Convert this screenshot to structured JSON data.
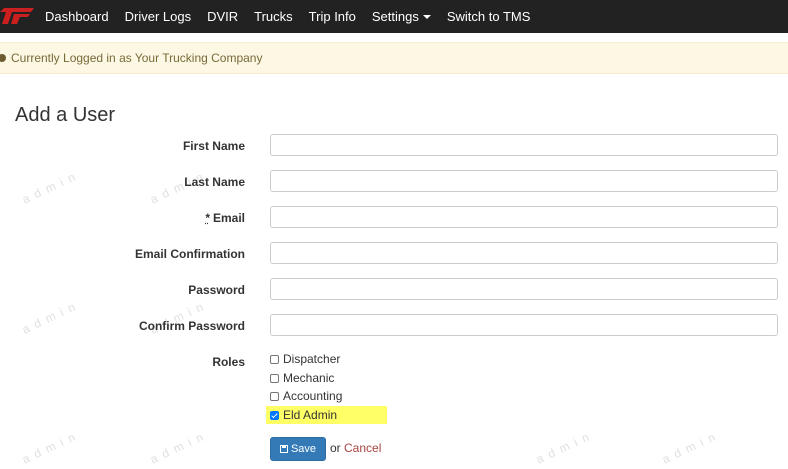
{
  "navbar": {
    "items": [
      "Dashboard",
      "Driver Logs",
      "DVIR",
      "Trucks",
      "Trip Info",
      "Settings",
      "Switch to TMS"
    ],
    "brand_color": "#cc1f1f"
  },
  "alert": {
    "text": "Currently Logged in as Your Trucking Company"
  },
  "form": {
    "title": "Add a User",
    "required_marker": "*",
    "fields": [
      {
        "label": "First Name",
        "value": ""
      },
      {
        "label": "Last Name",
        "value": ""
      },
      {
        "label": "Email",
        "value": ""
      },
      {
        "label": "Email Confirmation",
        "value": ""
      },
      {
        "label": "Password",
        "value": ""
      },
      {
        "label": "Confirm Password",
        "value": ""
      }
    ],
    "roles_label": "Roles",
    "roles": [
      {
        "label": "Dispatcher",
        "checked": false
      },
      {
        "label": "Mechanic",
        "checked": false
      },
      {
        "label": "Accounting",
        "checked": false
      },
      {
        "label": "Eld Admin",
        "checked": true
      }
    ],
    "save_label": "Save",
    "or_text": "or",
    "cancel_label": "Cancel"
  },
  "watermark": "admin"
}
